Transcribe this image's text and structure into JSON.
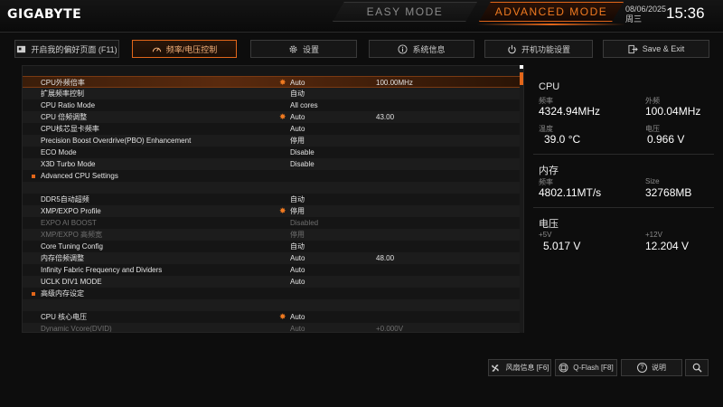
{
  "header": {
    "logo": "GIGABYTE",
    "easy_mode": "EASY MODE",
    "advanced_mode": "ADVANCED MODE",
    "date": "08/06/2025",
    "weekday": "周三",
    "time": "15:36",
    "accent_color": "#e2661a"
  },
  "tabs": [
    {
      "label": "开启我的偏好页面 (F11)",
      "icon": "bookmark-icon"
    },
    {
      "label": "频率/电压控制",
      "icon": "gauge-icon"
    },
    {
      "label": "设置",
      "icon": "gear-icon"
    },
    {
      "label": "系统信息",
      "icon": "info-icon"
    },
    {
      "label": "开机功能设置",
      "icon": "power-icon"
    },
    {
      "label": "Save & Exit",
      "icon": "exit-icon"
    }
  ],
  "settings": [
    {
      "label": "CPU外频倍率",
      "value": "Auto",
      "value2": "100.00MHz",
      "star": true,
      "state": "selected"
    },
    {
      "label": "扩展频率控制",
      "value": "自动",
      "value2": "",
      "star": false,
      "state": "normal"
    },
    {
      "label": "CPU Ratio Mode",
      "value": "All cores",
      "value2": "",
      "star": false,
      "state": "normal"
    },
    {
      "label": "CPU 倍频调整",
      "value": "Auto",
      "value2": "43.00",
      "star": true,
      "state": "normal"
    },
    {
      "label": "CPU核芯显卡频率",
      "value": "Auto",
      "value2": "",
      "star": false,
      "state": "normal"
    },
    {
      "label": "Precision Boost Overdrive(PBO) Enhancement",
      "value": "停用",
      "value2": "",
      "star": false,
      "state": "normal"
    },
    {
      "label": "ECO Mode",
      "value": "Disable",
      "value2": "",
      "star": false,
      "state": "normal"
    },
    {
      "label": "X3D Turbo Mode",
      "value": "Disable",
      "value2": "",
      "star": false,
      "state": "normal"
    },
    {
      "label": "Advanced CPU Settings",
      "value": "",
      "value2": "",
      "star": false,
      "state": "submenu"
    },
    {
      "label": "",
      "value": "",
      "value2": "",
      "star": false,
      "state": "blank"
    },
    {
      "label": "DDR5自动超频",
      "value": "自动",
      "value2": "",
      "star": false,
      "state": "normal"
    },
    {
      "label": "XMP/EXPO Profile",
      "value": "停用",
      "value2": "",
      "star": true,
      "state": "normal"
    },
    {
      "label": "EXPO AI BOOST",
      "value": "Disabled",
      "value2": "",
      "star": false,
      "state": "dim"
    },
    {
      "label": "XMP/EXPO 高频宽",
      "value": "停用",
      "value2": "",
      "star": false,
      "state": "dim"
    },
    {
      "label": "Core Tuning Config",
      "value": "自动",
      "value2": "",
      "star": false,
      "state": "normal"
    },
    {
      "label": "内存倍频调整",
      "value": "Auto",
      "value2": "48.00",
      "star": false,
      "state": "normal"
    },
    {
      "label": "Infinity Fabric Frequency and Dividers",
      "value": "Auto",
      "value2": "",
      "star": false,
      "state": "normal"
    },
    {
      "label": "UCLK DIV1 MODE",
      "value": "Auto",
      "value2": "",
      "star": false,
      "state": "normal"
    },
    {
      "label": "高级内存设定",
      "value": "",
      "value2": "",
      "star": false,
      "state": "submenu"
    },
    {
      "label": "",
      "value": "",
      "value2": "",
      "star": false,
      "state": "blank"
    },
    {
      "label": "CPU 核心电压",
      "value": "Auto",
      "value2": "",
      "star": true,
      "state": "normal"
    },
    {
      "label": "Dynamic Vcore(DVID)",
      "value": "Auto",
      "value2": "+0.000V",
      "star": false,
      "state": "dim"
    }
  ],
  "info": {
    "cpu": {
      "title": "CPU",
      "freq_label": "频率",
      "freq": "4324.94MHz",
      "bclk_label": "外频",
      "bclk": "100.04MHz",
      "temp_label": "温度",
      "temp": "39.0 °C",
      "volt_label": "电压",
      "volt": "0.966 V"
    },
    "memory": {
      "title": "内存",
      "freq_label": "频率",
      "freq": "4802.11MT/s",
      "size_label": "Size",
      "size": "32768MB"
    },
    "voltage": {
      "title": "电压",
      "v5_label": "+5V",
      "v5": "5.017 V",
      "v12_label": "+12V",
      "v12": "12.204 V"
    }
  },
  "footer": {
    "fan": "风扇信息 [F6]",
    "qflash": "Q-Flash [F8]",
    "help": "说明"
  }
}
